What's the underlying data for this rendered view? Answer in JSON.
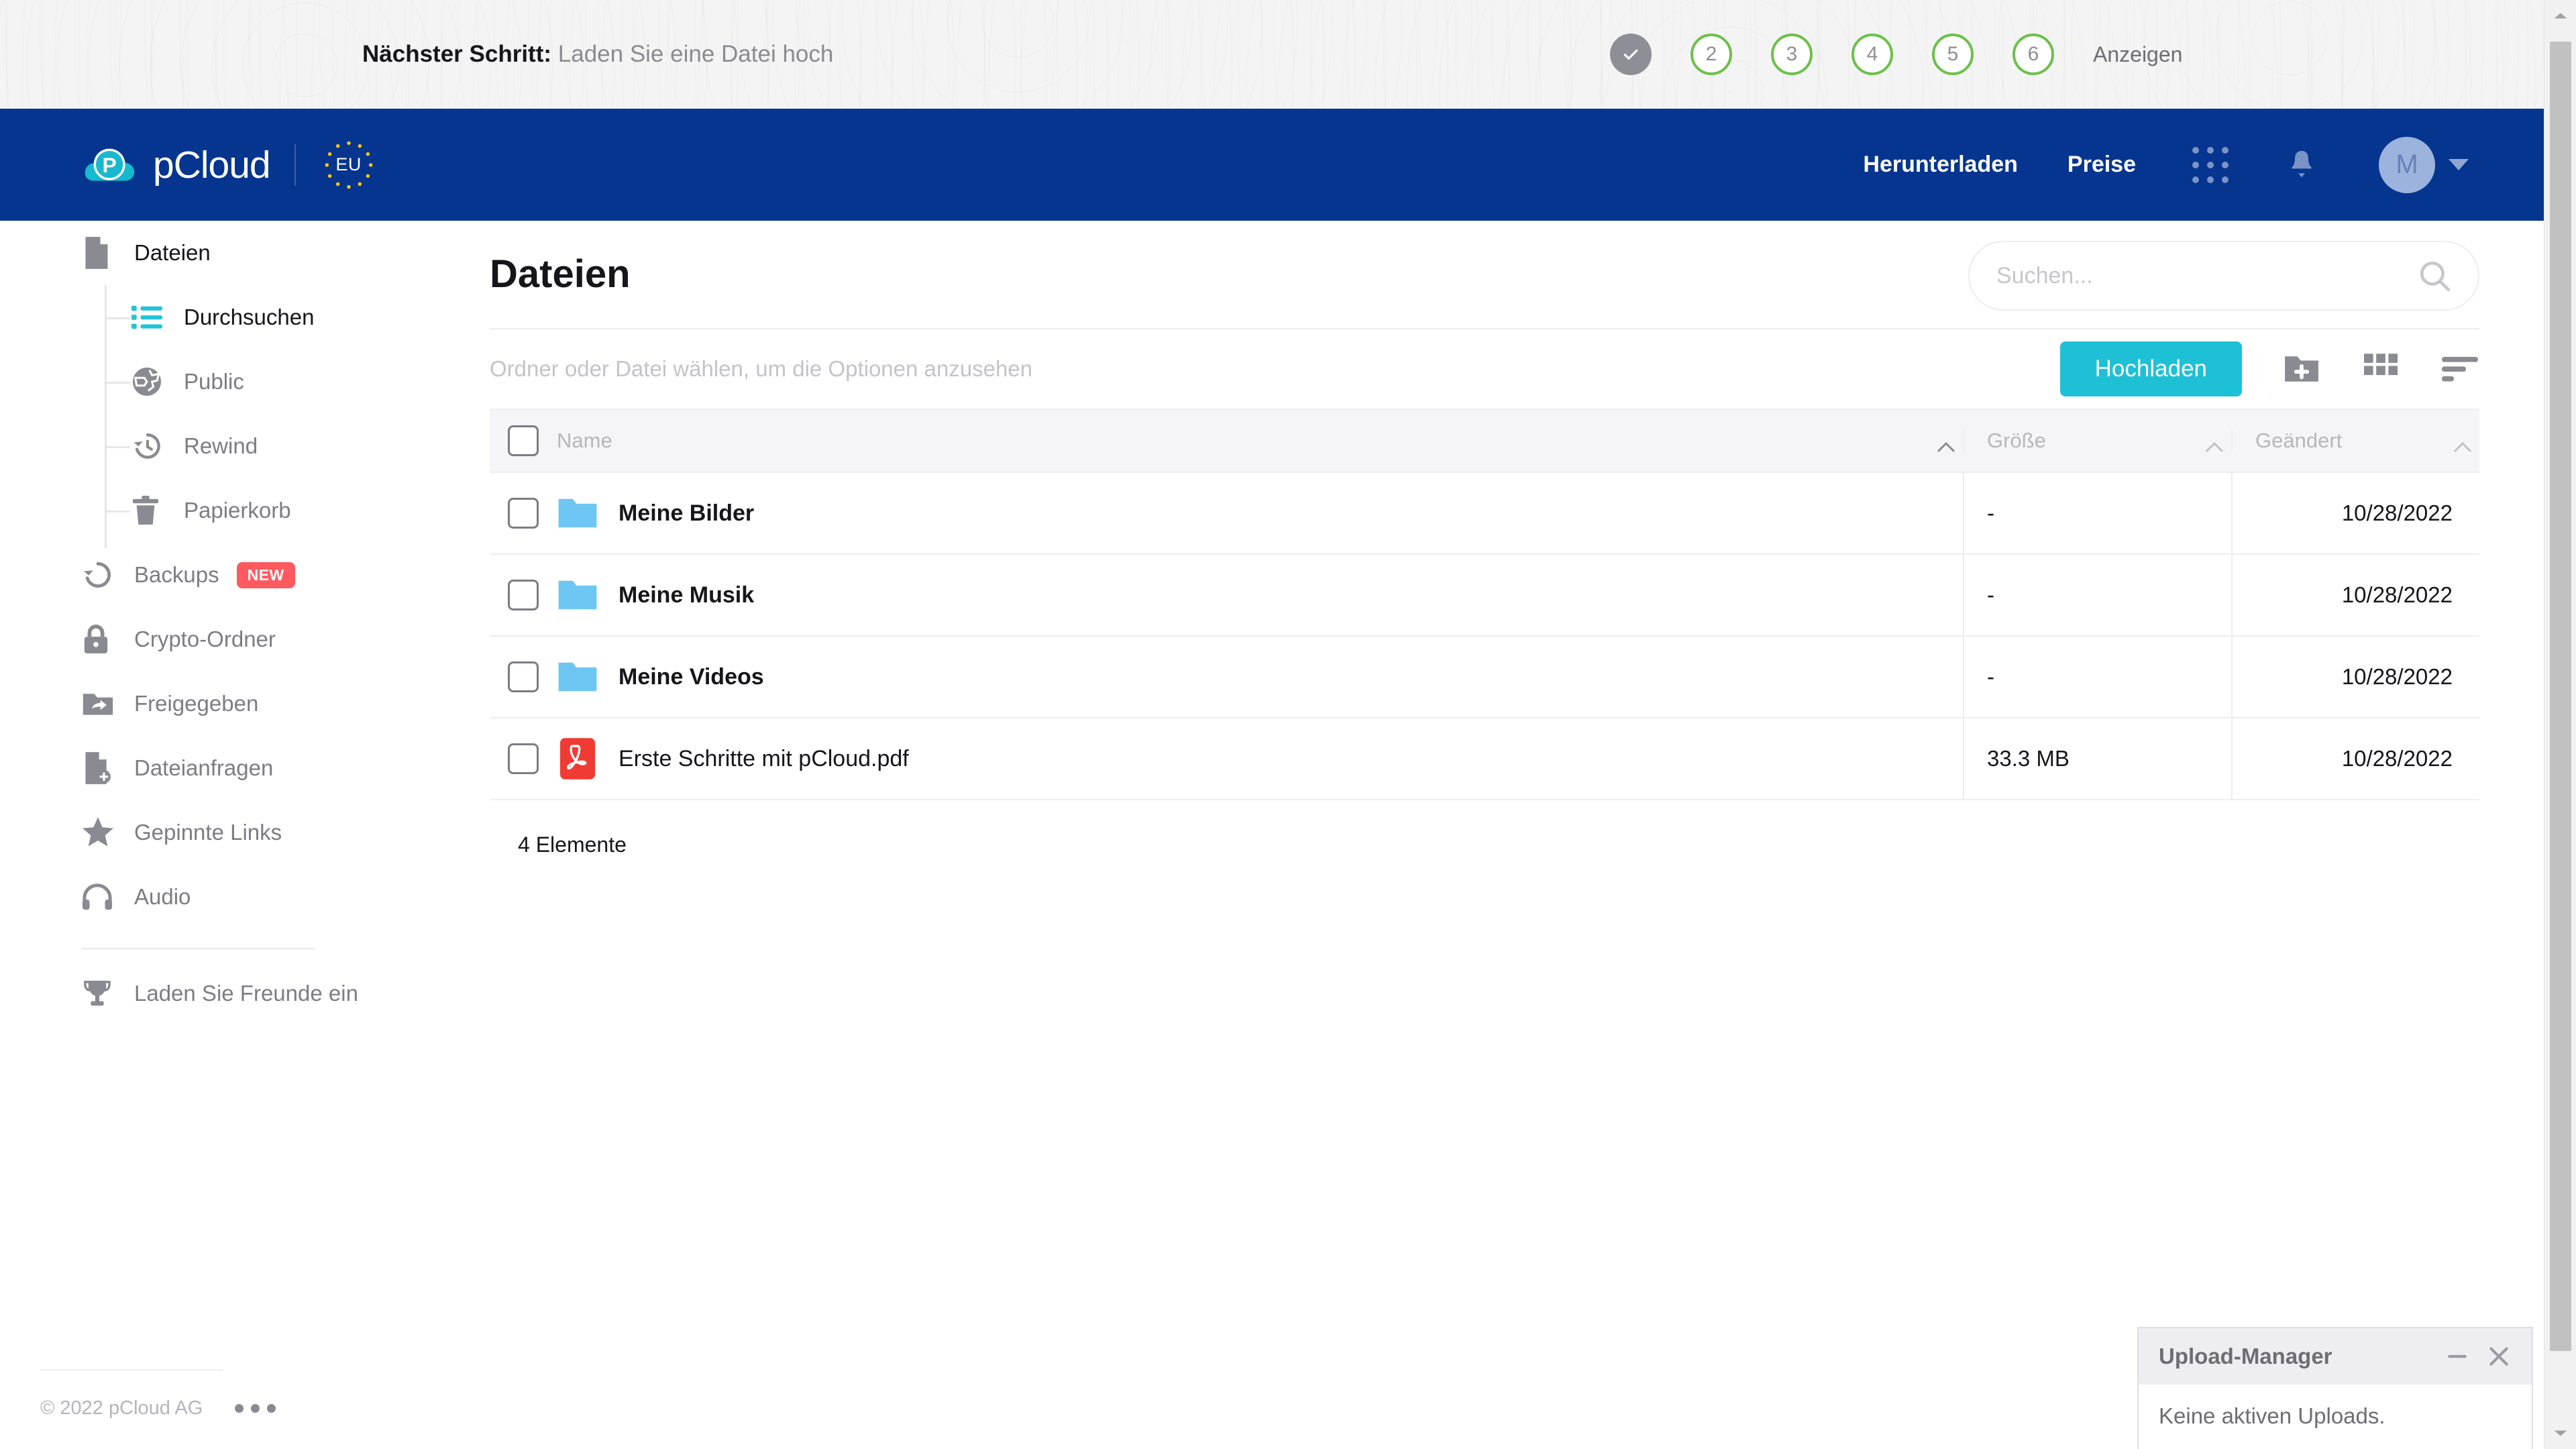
{
  "onboarding": {
    "lead": "Nächster Schritt:",
    "subtitle": "Laden Sie eine Datei hoch",
    "steps": [
      {
        "label": "✓",
        "state": "done"
      },
      {
        "label": "2",
        "state": "pending"
      },
      {
        "label": "3",
        "state": "pending"
      },
      {
        "label": "4",
        "state": "pending"
      },
      {
        "label": "5",
        "state": "pending"
      },
      {
        "label": "6",
        "state": "pending"
      }
    ],
    "view_link": "Anzeigen",
    "done_color": "#8e8e96",
    "pending_color": "#6cc04a"
  },
  "header": {
    "brand": "pCloud",
    "eu_label": "EU",
    "nav": [
      {
        "label": "Herunterladen",
        "name": "nav-download"
      },
      {
        "label": "Preise",
        "name": "nav-pricing"
      }
    ],
    "avatar_initial": "M",
    "bg_color": "#05358f",
    "logo_color": "#17b9cf"
  },
  "sidebar": {
    "root": {
      "label": "Dateien",
      "icon": "file-icon"
    },
    "children": [
      {
        "label": "Durchsuchen",
        "icon": "list-icon",
        "active": true
      },
      {
        "label": "Public",
        "icon": "globe-icon",
        "active": false
      },
      {
        "label": "Rewind",
        "icon": "rewind-clock-icon",
        "active": false
      },
      {
        "label": "Papierkorb",
        "icon": "trash-icon",
        "active": false
      }
    ],
    "items": [
      {
        "label": "Backups",
        "icon": "rewind-icon",
        "badge": "NEW"
      },
      {
        "label": "Crypto-Ordner",
        "icon": "lock-icon",
        "badge": ""
      },
      {
        "label": "Freigegeben",
        "icon": "folder-share-icon",
        "badge": ""
      },
      {
        "label": "Dateianfragen",
        "icon": "file-request-icon",
        "badge": ""
      },
      {
        "label": "Gepinnte Links",
        "icon": "star-icon",
        "badge": ""
      },
      {
        "label": "Audio",
        "icon": "headphones-icon",
        "badge": ""
      }
    ],
    "invite": {
      "label": "Laden Sie Freunde ein",
      "icon": "trophy-icon"
    },
    "badge_color": "#ff5a5f"
  },
  "footer": {
    "copyright": "© 2022 pCloud AG",
    "more_icon": "ellipsis-icon"
  },
  "main": {
    "page_title": "Dateien",
    "search": {
      "placeholder": "Suchen...",
      "value": "",
      "icon": "search-icon"
    },
    "toolbar": {
      "hint": "Ordner oder Datei wählen, um die Optionen anzusehen",
      "upload_label": "Hochladen",
      "upload_color": "#1ec0d6",
      "new_folder_icon": "new-folder-icon",
      "grid_view_icon": "grid-view-icon",
      "sort_icon": "sort-icon"
    },
    "table": {
      "columns": [
        {
          "label": "Name",
          "sort": "asc"
        },
        {
          "label": "Größe",
          "sort": "asc"
        },
        {
          "label": "Geändert",
          "sort": "asc"
        }
      ],
      "rows": [
        {
          "name": "Meine Bilder",
          "type": "folder",
          "icon": "folder-icon",
          "size": "-",
          "modified": "10/28/2022"
        },
        {
          "name": "Meine Musik",
          "type": "folder",
          "icon": "folder-icon",
          "size": "-",
          "modified": "10/28/2022"
        },
        {
          "name": "Meine Videos",
          "type": "folder",
          "icon": "folder-icon",
          "size": "-",
          "modified": "10/28/2022"
        },
        {
          "name": "Erste Schritte mit pCloud.pdf",
          "type": "file",
          "icon": "pdf-icon",
          "size": "33.3 MB",
          "modified": "10/28/2022"
        }
      ],
      "count_label": "4 Elemente"
    }
  },
  "upload_manager": {
    "title": "Upload-Manager",
    "body": "Keine aktiven Uploads.",
    "minimize_icon": "minimize-icon",
    "close_icon": "close-icon"
  }
}
